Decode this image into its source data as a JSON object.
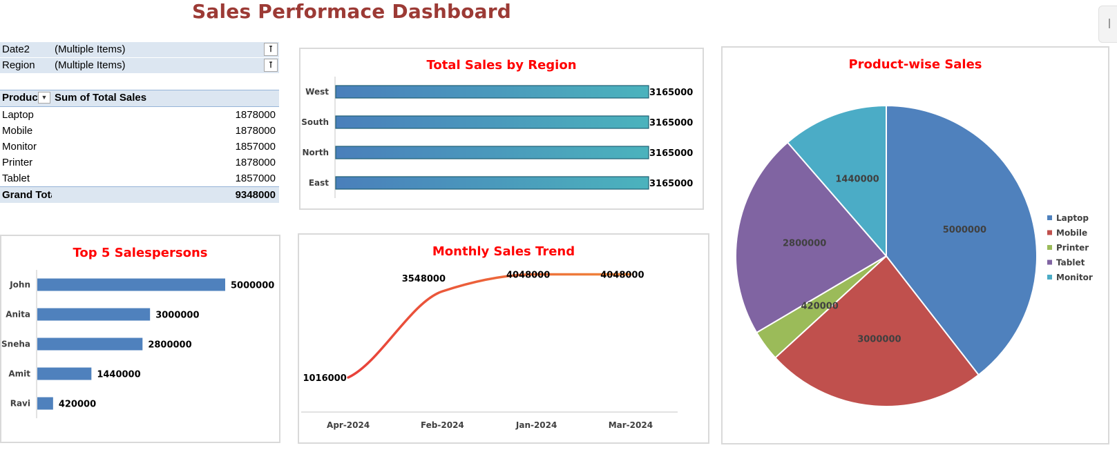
{
  "dashboard": {
    "title": "Sales Performace Dashboard"
  },
  "filters": [
    {
      "label": "Date2",
      "value": "(Multiple Items)",
      "icon": "filter-icon"
    },
    {
      "label": "Region",
      "value": "(Multiple Items)",
      "icon": "filter-icon"
    }
  ],
  "pivot": {
    "header_product": "Product",
    "header_sum": "Sum of Total Sales",
    "dropdown_icon": "dropdown-arrow-icon",
    "rows": [
      {
        "product": "Laptop",
        "value": "1878000"
      },
      {
        "product": "Mobile",
        "value": "1878000"
      },
      {
        "product": "Monitor",
        "value": "1857000"
      },
      {
        "product": "Printer",
        "value": "1878000"
      },
      {
        "product": "Tablet",
        "value": "1857000"
      }
    ],
    "total_label": "Grand Total",
    "total_value": "9348000"
  },
  "colors": {
    "title": "#9c3a35",
    "chart_title": "#ff0000",
    "bar_blue": "#4f81bd",
    "line_start": "#e8403a",
    "line_end": "#f0883a",
    "header_fill": "#dce6f1"
  },
  "chart_data": [
    {
      "id": "region",
      "type": "bar",
      "orientation": "horizontal",
      "title": "Total Sales by Region",
      "categories": [
        "West",
        "South",
        "North",
        "East"
      ],
      "values": [
        3165000,
        3165000,
        3165000,
        3165000
      ],
      "data_labels": [
        "3165000",
        "3165000",
        "3165000",
        "3165000"
      ]
    },
    {
      "id": "salespersons",
      "type": "bar",
      "orientation": "horizontal",
      "title": "Top 5 Salespersons",
      "categories": [
        "John",
        "Anita",
        "Sneha",
        "Amit",
        "Ravi"
      ],
      "values": [
        5000000,
        3000000,
        2800000,
        1440000,
        420000
      ],
      "data_labels": [
        "5000000",
        "3000000",
        "2800000",
        "1440000",
        "420000"
      ]
    },
    {
      "id": "monthly",
      "type": "line",
      "title": "Monthly Sales Trend",
      "categories": [
        "Apr-2024",
        "Feb-2024",
        "Jan-2024",
        "Mar-2024"
      ],
      "values": [
        1016000,
        3548000,
        4048000,
        4048000
      ],
      "data_labels": [
        "1016000",
        "3548000",
        "4048000",
        "4048000"
      ]
    },
    {
      "id": "product",
      "type": "pie",
      "title": "Product-wise Sales",
      "legend_position": "right",
      "slices": [
        {
          "name": "Laptop",
          "value": 5000000,
          "label": "5000000",
          "color": "#4f81bd"
        },
        {
          "name": "Mobile",
          "value": 3000000,
          "label": "3000000",
          "color": "#c0504d"
        },
        {
          "name": "Printer",
          "value": 420000,
          "label": "420000",
          "color": "#9bbb59"
        },
        {
          "name": "Tablet",
          "value": 2800000,
          "label": "2800000",
          "color": "#8064a2"
        },
        {
          "name": "Monitor",
          "value": 1440000,
          "label": "1440000",
          "color": "#4bacc6"
        }
      ]
    }
  ]
}
